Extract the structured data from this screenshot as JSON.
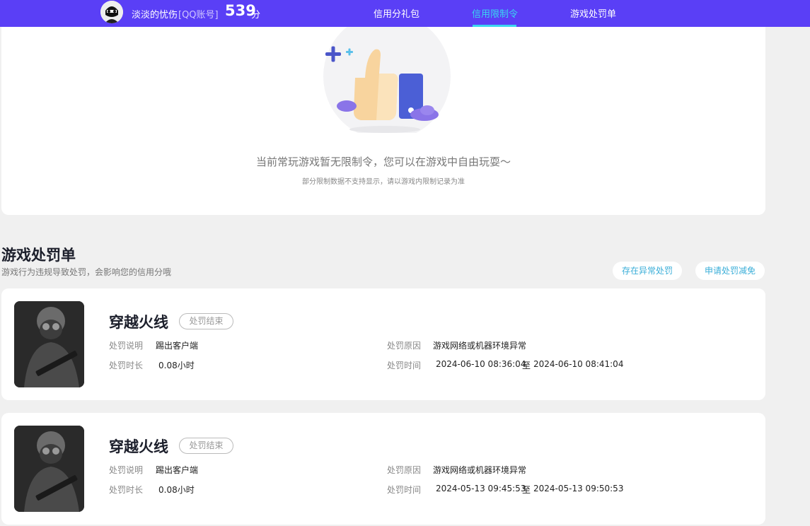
{
  "header": {
    "user_name": "淡淡的忧伤",
    "account_tag": "[QQ账号]",
    "score": "539",
    "score_unit": "分",
    "tabs": [
      {
        "label": "信用分礼包",
        "active": false
      },
      {
        "label": "信用限制令",
        "active": true
      },
      {
        "label": "游戏处罚单",
        "active": false
      }
    ]
  },
  "restriction": {
    "empty_message": "当前常玩游戏暂无限制令，您可以在游戏中自由玩耍～",
    "empty_note": "部分限制数据不支持显示，请以游戏内限制记录为准"
  },
  "penalty_section": {
    "title": "游戏处罚单",
    "subtitle": "游戏行为违规导致处罚，会影响您的信用分哦",
    "appeal_button": "存在异常处罚",
    "reduce_button": "申请处罚减免",
    "labels": {
      "desc": "处罚说明",
      "duration": "处罚时长",
      "reason": "处罚原因",
      "time": "处罚时间",
      "to": "至"
    },
    "items": [
      {
        "game": "穿越火线",
        "status": "处罚结束",
        "desc": "踢出客户端",
        "duration": "0.08小时",
        "reason": "游戏网络或机器环境异常",
        "start": "2024-06-10 08:36:04",
        "end": "2024-06-10 08:41:04"
      },
      {
        "game": "穿越火线",
        "status": "处罚结束",
        "desc": "踢出客户端",
        "duration": "0.08小时",
        "reason": "游戏网络或机器环境异常",
        "start": "2024-05-13 09:45:53",
        "end": "2024-05-13 09:50:53"
      }
    ]
  },
  "colors": {
    "header_bg": "#5a3ff6",
    "active_tab": "#3ad6f0",
    "pill_text": "#3aaed8"
  },
  "icons": {
    "illustration": "thumbs-up-icon"
  }
}
